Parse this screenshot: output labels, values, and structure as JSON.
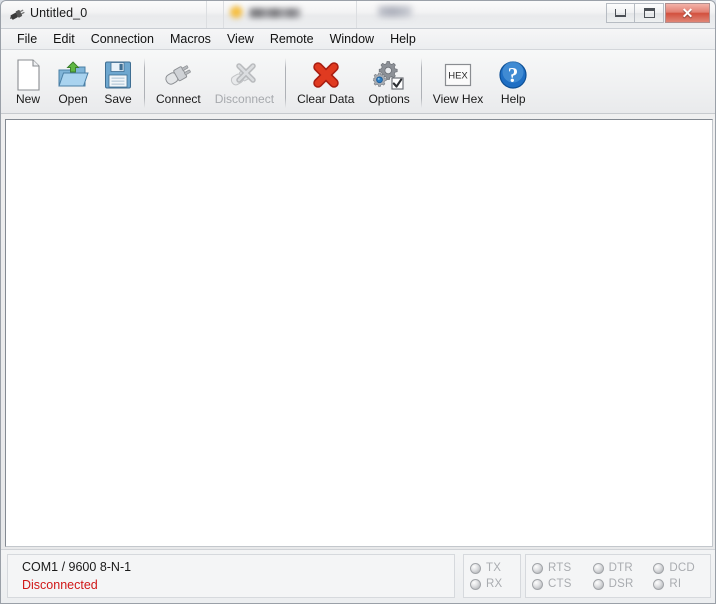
{
  "window": {
    "title": "Untitled_0",
    "icon": "serial-plug-icon",
    "controls": {
      "minimize": "Minimize",
      "maximize": "Maximize",
      "close": "Close",
      "close_glyph": "✕"
    },
    "overlay_redacted": [
      "blurred-orange-icon",
      "blurred-text-label",
      "blurred-text-right"
    ]
  },
  "menu": {
    "items": [
      {
        "label": "File",
        "name": "menu-file"
      },
      {
        "label": "Edit",
        "name": "menu-edit"
      },
      {
        "label": "Connection",
        "name": "menu-connection"
      },
      {
        "label": "Macros",
        "name": "menu-macros"
      },
      {
        "label": "View",
        "name": "menu-view"
      },
      {
        "label": "Remote",
        "name": "menu-remote"
      },
      {
        "label": "Window",
        "name": "menu-window"
      },
      {
        "label": "Help",
        "name": "menu-help"
      }
    ]
  },
  "toolbar": {
    "buttons": [
      {
        "label": "New",
        "icon": "new-document-icon",
        "enabled": true
      },
      {
        "label": "Open",
        "icon": "open-folder-icon",
        "enabled": true
      },
      {
        "label": "Save",
        "icon": "save-floppy-icon",
        "enabled": true
      },
      {
        "label": "Connect",
        "icon": "usb-connect-icon",
        "enabled": true
      },
      {
        "label": "Disconnect",
        "icon": "usb-disconnect-icon",
        "enabled": false
      },
      {
        "label": "Clear Data",
        "icon": "red-x-icon",
        "enabled": true
      },
      {
        "label": "Options",
        "icon": "gears-options-icon",
        "enabled": true
      },
      {
        "label": "View Hex",
        "icon": "hex-button-icon",
        "enabled": true
      },
      {
        "label": "Help",
        "icon": "help-question-icon",
        "enabled": true
      }
    ],
    "hex_glyph": "HEX",
    "help_glyph": "?"
  },
  "terminal": {
    "content": "",
    "background": "#ffffff"
  },
  "status": {
    "port_settings": "COM1 / 9600 8-N-1",
    "connection_state": "Disconnected",
    "connection_state_color": "#d01818",
    "data_leds": [
      {
        "label": "TX",
        "on": false
      },
      {
        "label": "RX",
        "on": false
      }
    ],
    "control_leds_row1": [
      {
        "label": "RTS",
        "on": false
      },
      {
        "label": "DTR",
        "on": false
      },
      {
        "label": "DCD",
        "on": false
      }
    ],
    "control_leds_row2": [
      {
        "label": "CTS",
        "on": false
      },
      {
        "label": "DSR",
        "on": false
      },
      {
        "label": "RI",
        "on": false
      }
    ]
  },
  "colors": {
    "accent": "#2b6cb0",
    "error": "#d01818",
    "led_off": "#c2c4c7",
    "chrome": "#eceef0"
  }
}
